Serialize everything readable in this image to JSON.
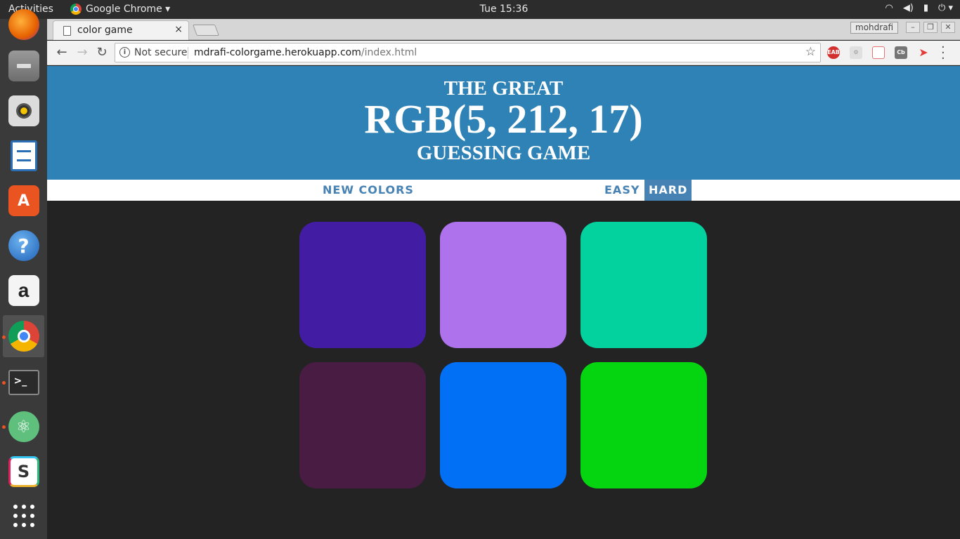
{
  "topbar": {
    "activities": "Activities",
    "app_name": "Google Chrome ▾",
    "clock": "Tue 15:36",
    "tray": [
      "wifi-icon",
      "volume-icon",
      "battery-icon",
      "power-icon"
    ]
  },
  "launcher": {
    "apps": [
      {
        "name": "firefox",
        "icon": "firefox-icon",
        "color": "#e66000"
      },
      {
        "name": "files",
        "icon": "files-icon",
        "color": "#7a7a7a"
      },
      {
        "name": "rhythmbox",
        "icon": "speaker-icon",
        "color": "#d9d9d9"
      },
      {
        "name": "libreoffice-writer",
        "icon": "document-icon",
        "color": "#2a6fb6"
      },
      {
        "name": "software-center",
        "icon": "shopping-bag-icon",
        "color": "#e95420"
      },
      {
        "name": "help",
        "icon": "help-icon",
        "color": "#2f7fd0"
      },
      {
        "name": "amazon",
        "icon": "amazon-icon",
        "color": "#f2f2f2"
      },
      {
        "name": "chrome",
        "icon": "chrome-icon",
        "color": "#4285f4"
      },
      {
        "name": "terminal",
        "icon": "terminal-icon",
        "color": "#2b2b2b"
      },
      {
        "name": "atom",
        "icon": "atom-icon",
        "color": "#5fc07e"
      },
      {
        "name": "slack",
        "icon": "slack-icon",
        "color": "#ffffff"
      },
      {
        "name": "show-applications",
        "icon": "grid-icon",
        "color": "#ffffff"
      }
    ]
  },
  "browser": {
    "tab_title": "color game",
    "tab_close": "×",
    "profile": "mohdrafi",
    "security": "Not secure",
    "url_host": "mdrafi-colorgame.herokuapp.com",
    "url_path": "/index.html",
    "extensions": [
      {
        "icon": "eab-icon",
        "label": "EAB",
        "color": "#d32f2f"
      },
      {
        "icon": "gear-ext-icon",
        "label": "",
        "color": "#bdbdbd"
      },
      {
        "icon": "calendar-ext-icon",
        "label": "",
        "color": "#e57373"
      },
      {
        "icon": "cb-ext-icon",
        "label": "Cb",
        "color": "#757575"
      },
      {
        "icon": "bird-ext-icon",
        "label": "",
        "color": "#e53935"
      }
    ]
  },
  "game": {
    "title_top": "THE GREAT",
    "rgb_display": "RGB(5, 212, 17)",
    "title_bottom": "GUESSING GAME",
    "new_colors": "NEW COLORS",
    "message": "",
    "easy": "EASY",
    "hard": "HARD",
    "selected_mode": "HARD",
    "header_color": "#2e82b5",
    "squares": [
      {
        "color": "#421da3"
      },
      {
        "color": "#ae73ec"
      },
      {
        "color": "#03d29f"
      },
      {
        "color": "#491c44"
      },
      {
        "color": "#0170f4"
      },
      {
        "color": "#05d411"
      }
    ]
  }
}
